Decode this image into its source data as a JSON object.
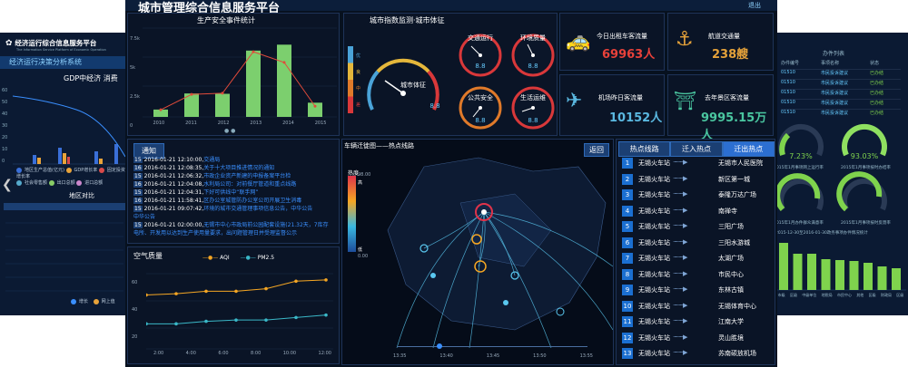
{
  "left": {
    "brand": "经济运行综合信息服务平台",
    "brand_sub": "The Information Service Platform of Economic Operation",
    "nav": "经济运行决策分析系统",
    "chart_title": "GDP中经济 消费",
    "legend": [
      "地区生产总值(亿元)",
      "GDP增长率",
      "固定投资增长率",
      "社会零售额",
      "出口总额",
      "进口总额"
    ],
    "region_title": "地区对比",
    "bottom_legend": [
      "增长",
      "网上值"
    ],
    "y_ticks": [
      "60",
      "50",
      "40",
      "30",
      "20",
      "10",
      "0"
    ],
    "nav_arrow": "❮"
  },
  "main": {
    "title": "城市管理综合信息服务平台",
    "logout": "退出",
    "safety": {
      "title": "生产安全事件统计",
      "years": [
        "2010",
        "2011",
        "2012",
        "2013",
        "2014",
        "2015"
      ],
      "y_ticks": [
        "7.5k",
        "5k",
        "2.5k",
        "0"
      ]
    },
    "index_title": "城市指数监测·城市体征",
    "index_levels": [
      "优",
      "良",
      "中",
      "差"
    ],
    "gauges": [
      {
        "label": "城市体征",
        "value": "8.8"
      },
      {
        "label": "交通运行",
        "value": "8.8"
      },
      {
        "label": "环境质量",
        "value": "8.8"
      },
      {
        "label": "公共安全",
        "value": "8.8"
      },
      {
        "label": "生活运维",
        "value": "8.8"
      }
    ],
    "taxi": {
      "label": "今日出租车客流量",
      "value": "69963人"
    },
    "ship": {
      "label": "航道交通量",
      "value": "238艘"
    },
    "airport": {
      "label": "机场昨日客流量",
      "value": "10152人"
    },
    "scenic": {
      "label": "去年景区客流量",
      "value": "9995.15万人"
    },
    "notice": {
      "tab": "通知",
      "items": [
        {
          "no": "15",
          "date": "2016-01-21 12:10:00,",
          "text": "交通局"
        },
        {
          "no": "16",
          "date": "2016-01-21 12:08:35,",
          "text": "关于十大项目推进情况的通知"
        },
        {
          "no": "15",
          "date": "2016-01-21 12:06:32,",
          "text": "市政企业资产新建的申报备案平台检"
        },
        {
          "no": "16",
          "date": "2016-01-21 12:04:08,",
          "text": "水利局公司：对前餐厅管道和重点线路"
        },
        {
          "no": "15",
          "date": "2016-01-21 12:04:31,",
          "text": "下好可供线中“联手网”"
        },
        {
          "no": "16",
          "date": "2016-01-21 11:58:41,",
          "text": "区办公室城管防办公室公司开展卫生消毒"
        },
        {
          "no": "15",
          "date": "2016-01-21 09:07:42,",
          "text": "环境的城市交通管理事项信息公告，中华公告"
        },
        {
          "no": "",
          "date": "",
          "text": "中华公告"
        },
        {
          "no": "15",
          "date": "2016-01-21 02:00:00,",
          "text": "无锡市中心市政局前公园配套设施(21.32天，7库存"
        },
        {
          "no": "",
          "date": "",
          "text": "电所、开发用以达到生产使用量要求，出问题管理日并受理监督公示"
        }
      ]
    },
    "air": {
      "title": "空气质量",
      "legend_aqi": "AQI",
      "legend_pm": "PM2.5",
      "times": [
        "2:00",
        "4:00",
        "6:00",
        "8:00",
        "10:00",
        "12:00"
      ],
      "y_ticks": [
        "60",
        "40",
        "20"
      ]
    },
    "map": {
      "title": "车辆迁徙图——热点线路",
      "back": "返回",
      "heat_title": "热度",
      "heat_high": "高",
      "heat_low": "低",
      "heat_max": "98.00",
      "heat_min": "0.00",
      "times": [
        "13:35",
        "13:40",
        "13:45",
        "13:50",
        "13:55"
      ]
    },
    "routes": {
      "tabs": [
        "热点线路",
        "迁入热点",
        "迁出热点"
      ],
      "items": [
        {
          "no": "1",
          "src": "无锡火车站",
          "dest": "无锡市人民医院"
        },
        {
          "no": "2",
          "src": "无锡火车站",
          "dest": "新区第一城"
        },
        {
          "no": "3",
          "src": "无锡火车站",
          "dest": "泰隆万达广场"
        },
        {
          "no": "4",
          "src": "无锡火车站",
          "dest": "南禅寺"
        },
        {
          "no": "5",
          "src": "无锡火车站",
          "dest": "三阳广场"
        },
        {
          "no": "6",
          "src": "无锡火车站",
          "dest": "三阳水游城"
        },
        {
          "no": "7",
          "src": "无锡火车站",
          "dest": "太湖广场"
        },
        {
          "no": "8",
          "src": "无锡火车站",
          "dest": "市民中心"
        },
        {
          "no": "9",
          "src": "无锡火车站",
          "dest": "东林古镇"
        },
        {
          "no": "10",
          "src": "无锡火车站",
          "dest": "无锡体育中心"
        },
        {
          "no": "11",
          "src": "无锡火车站",
          "dest": "江南大学"
        },
        {
          "no": "12",
          "src": "无锡火车站",
          "dest": "灵山胜境"
        },
        {
          "no": "13",
          "src": "无锡火车站",
          "dest": "苏南硕放机场"
        }
      ]
    }
  },
  "right": {
    "list_title": "办件列表",
    "headers": [
      "办件编号",
      "事项名称",
      "状态"
    ],
    "rows": [
      [
        "01510",
        "市民投诉建议",
        "已办结"
      ],
      [
        "01510",
        "市民投诉建议",
        "已办结"
      ],
      [
        "01510",
        "市民投诉建议",
        "已办结"
      ],
      [
        "01510",
        "市民投诉建议",
        "已办结"
      ],
      [
        "01510",
        "市民投诉建议",
        "已办结"
      ]
    ],
    "g1_value": "7.23%",
    "g1_label": "2015年1月事项网上运行率",
    "g2_value": "93.03%",
    "g2_label": "2015年1月事项按时办结率",
    "g3_value": "",
    "g3_label": "2015年1月办件群众满意率",
    "g4_value": "",
    "g4_label": "2015年1月事项按时反馈率",
    "bar_title": "2015-12-30至2016-01-30政务事项办件情况统计",
    "bar_cats": [
      "市级",
      "区级",
      "中级单位",
      "地税局",
      "市民中心",
      "其他",
      "区级",
      "财政局",
      "区级"
    ]
  }
}
